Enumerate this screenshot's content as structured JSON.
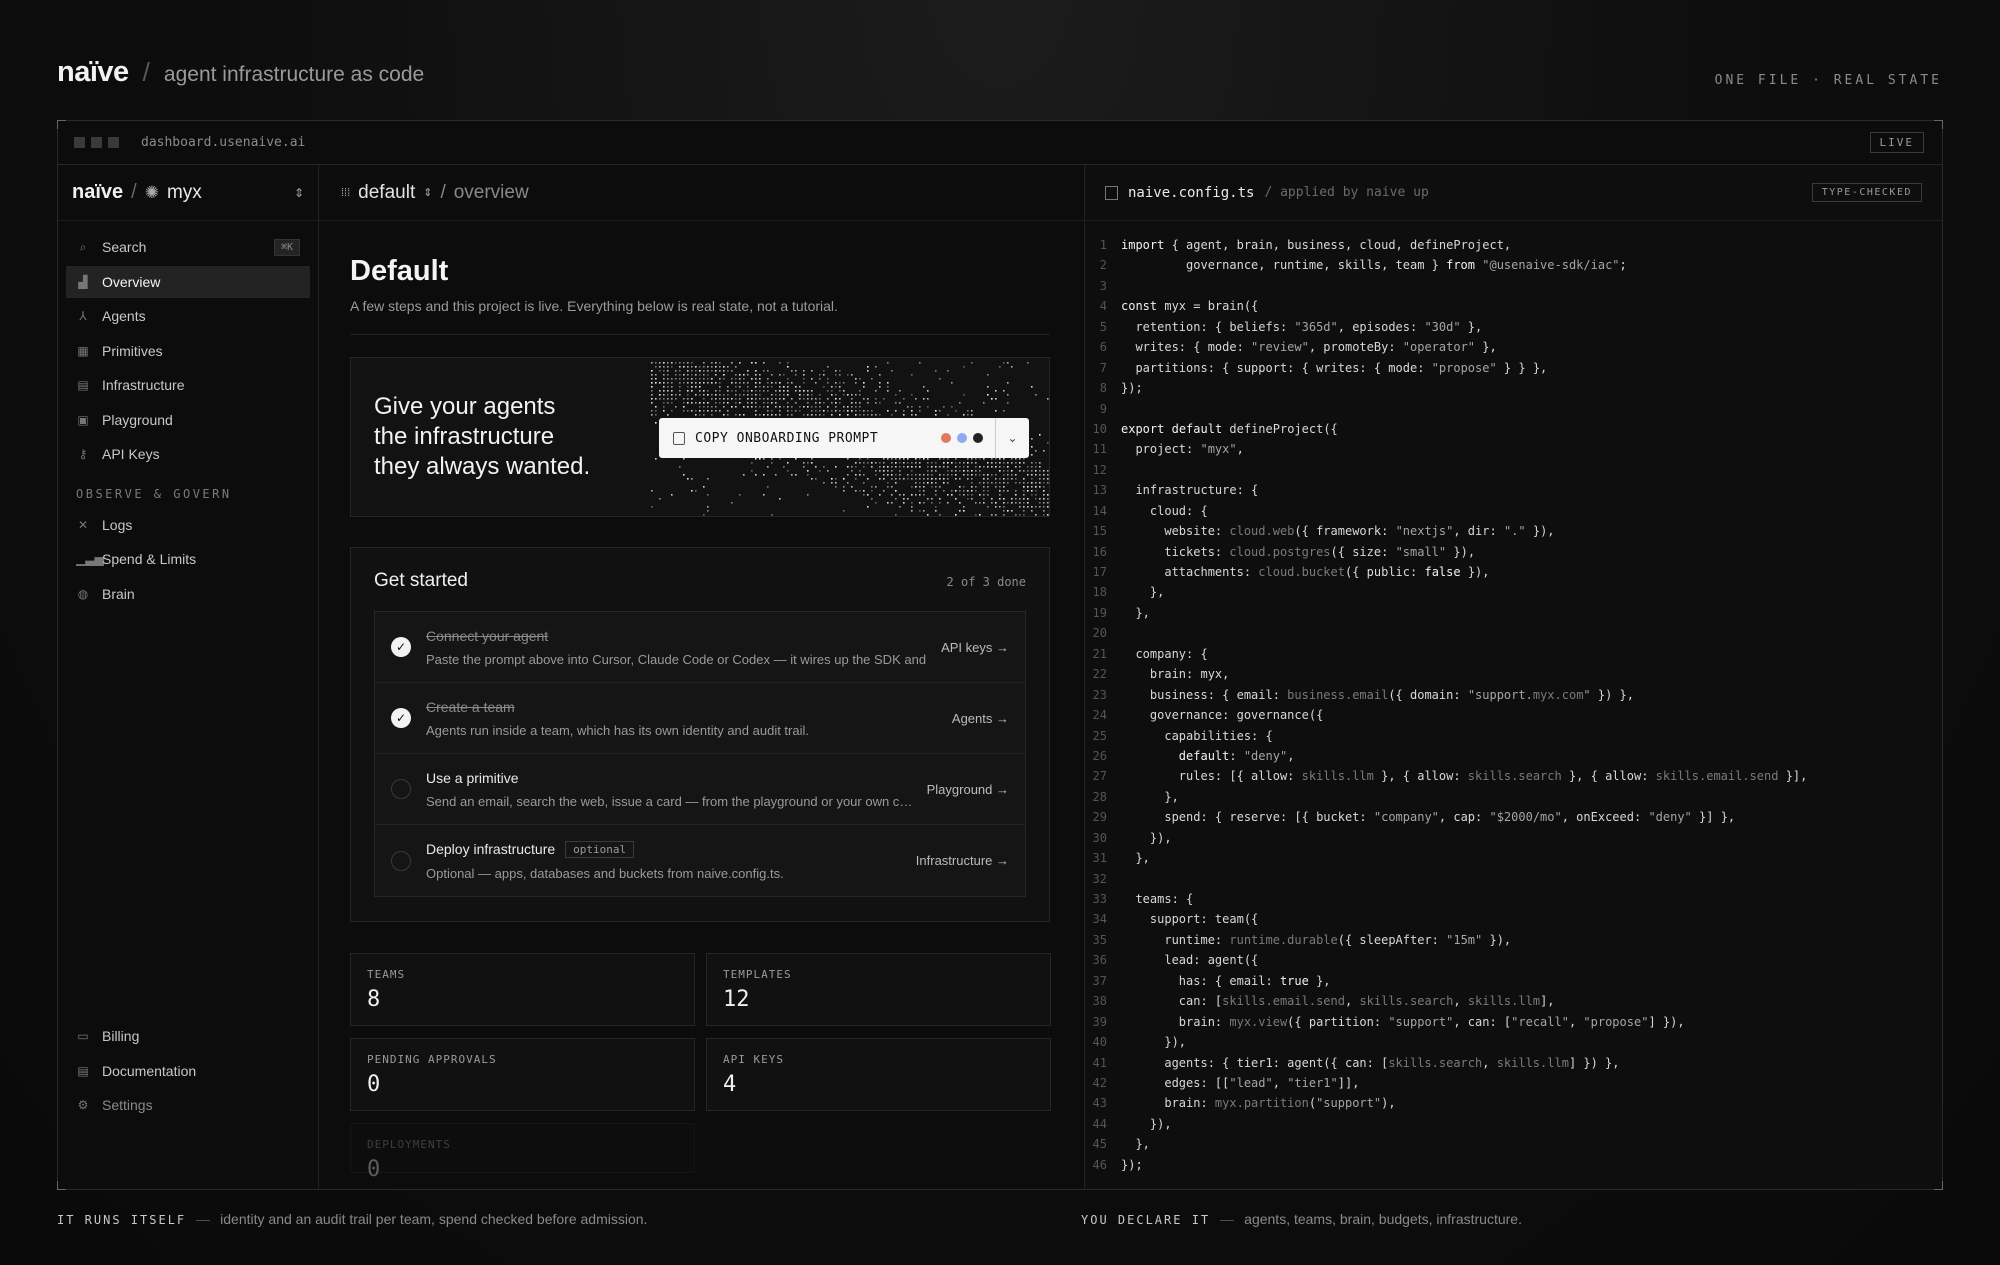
{
  "header": {
    "logo": "naïve",
    "slash": "/",
    "tagline": "agent infrastructure as code",
    "right": "ONE FILE · REAL STATE"
  },
  "window": {
    "url": "dashboard.usenaive.ai",
    "live": "LIVE"
  },
  "sidebar": {
    "logo": "naïve",
    "slash": "/",
    "project": "myx",
    "items": [
      {
        "label": "Search",
        "kbd": "⌘K"
      },
      {
        "label": "Overview"
      },
      {
        "label": "Agents"
      },
      {
        "label": "Primitives"
      },
      {
        "label": "Infrastructure"
      },
      {
        "label": "Playground"
      },
      {
        "label": "API Keys"
      }
    ],
    "section": "OBSERVE & GOVERN",
    "section_items": [
      {
        "label": "Logs"
      },
      {
        "label": "Spend & Limits"
      },
      {
        "label": "Brain"
      }
    ],
    "bottom_items": [
      {
        "label": "Billing"
      },
      {
        "label": "Documentation"
      },
      {
        "label": "Settings"
      }
    ]
  },
  "breadcrumb": {
    "env": "default",
    "sep": "/",
    "page": "overview"
  },
  "page": {
    "title": "Default",
    "subtitle": "A few steps and this project is live. Everything below is real state, not a tutorial."
  },
  "hero": {
    "line1": "Give your agents",
    "line2": "the infrastructure",
    "line3": "they always wanted.",
    "cta": "COPY ONBOARDING PROMPT",
    "brand_colors": [
      "#e07a5f",
      "#8ea8f5",
      "#222222"
    ]
  },
  "get_started": {
    "title": "Get started",
    "count": "2 of 3 done",
    "steps": [
      {
        "title": "Connect your agent",
        "desc": "Paste the prompt above into Cursor, Claude Code or Codex — it wires up the SDK and",
        "link": "API keys →",
        "done": true
      },
      {
        "title": "Create a team",
        "desc": "Agents run inside a team, which has its own identity and audit trail.",
        "link": "Agents →",
        "done": true
      },
      {
        "title": "Use a primitive",
        "desc": "Send an email, search the web, issue a card — from the playground or your own code.",
        "link": "Playground →",
        "done": false
      },
      {
        "title": "Deploy infrastructure",
        "badge": "optional",
        "desc": "Optional — apps, databases and buckets from naive.config.ts.",
        "link": "Infrastructure →",
        "done": false
      }
    ]
  },
  "stats": [
    {
      "label": "TEAMS",
      "value": "8"
    },
    {
      "label": "TEMPLATES",
      "value": "12"
    },
    {
      "label": "PENDING APPROVALS",
      "value": "0"
    },
    {
      "label": "API KEYS",
      "value": "4"
    },
    {
      "label": "DEPLOYMENTS",
      "value": "0"
    }
  ],
  "code": {
    "filename": "naive.config.ts",
    "sub": "/ applied by naive up",
    "badge": "TYPE-CHECKED",
    "lines": [
      "import { agent, brain, business, cloud, defineProject,",
      "         governance, runtime, skills, team } from \"@usenaive-sdk/iac\";",
      "",
      "const myx = brain({",
      "  retention: { beliefs: \"365d\", episodes: \"30d\" },",
      "  writes: { mode: \"review\", promoteBy: \"operator\" },",
      "  partitions: { support: { writes: { mode: \"propose\" } } },",
      "});",
      "",
      "export default defineProject({",
      "  project: \"myx\",",
      "",
      "  infrastructure: {",
      "    cloud: {",
      "      website: cloud.web({ framework: \"nextjs\", dir: \".\" }),",
      "      tickets: cloud.postgres({ size: \"small\" }),",
      "      attachments: cloud.bucket({ public: false }),",
      "    },",
      "  },",
      "",
      "  company: {",
      "    brain: myx,",
      "    business: { email: business.email({ domain: \"support.myx.com\" }) },",
      "    governance: governance({",
      "      capabilities: {",
      "        default: \"deny\",",
      "        rules: [{ allow: skills.llm }, { allow: skills.search }, { allow: skills.email.send }],",
      "      },",
      "      spend: { reserve: [{ bucket: \"company\", cap: \"$2000/mo\", onExceed: \"deny\" }] },",
      "    }),",
      "  },",
      "",
      "  teams: {",
      "    support: team({",
      "      runtime: runtime.durable({ sleepAfter: \"15m\" }),",
      "      lead: agent({",
      "        has: { email: true },",
      "        can: [skills.email.send, skills.search, skills.llm],",
      "        brain: myx.view({ partition: \"support\", can: [\"recall\", \"propose\"] }),",
      "      }),",
      "      agents: { tier1: agent({ can: [skills.search, skills.llm] }) },",
      "      edges: [[\"lead\", \"tier1\"]],",
      "      brain: myx.partition(\"support\"),",
      "    }),",
      "  },",
      "});"
    ]
  },
  "captions": [
    {
      "key": "IT RUNS ITSELF",
      "dash": "—",
      "text": "identity and an audit trail per team, spend checked before admission."
    },
    {
      "key": "YOU DECLARE IT",
      "dash": "—",
      "text": "agents, teams, brain, budgets, infrastructure."
    }
  ]
}
